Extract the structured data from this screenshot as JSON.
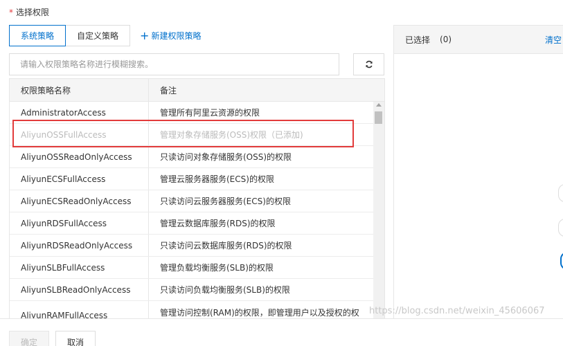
{
  "section": {
    "required_mark": "*",
    "label": "选择权限"
  },
  "tabs": [
    {
      "label": "系统策略",
      "active": true
    },
    {
      "label": "自定义策略",
      "active": false
    }
  ],
  "new_policy": {
    "plus": "+",
    "label": "新建权限策略"
  },
  "search": {
    "placeholder": "请输入权限策略名称进行模糊搜索。",
    "value": ""
  },
  "refresh": {
    "icon": "refresh-icon"
  },
  "table": {
    "headers": [
      "权限策略名称",
      "备注"
    ],
    "rows": [
      {
        "name": "AdministratorAccess",
        "note": "管理所有阿里云资源的权限",
        "disabled": false
      },
      {
        "name": "AliyunOSSFullAccess",
        "note": "管理对象存储服务(OSS)权限（已添加)",
        "disabled": true
      },
      {
        "name": "AliyunOSSReadOnlyAccess",
        "note": "只读访问对象存储服务(OSS)的权限",
        "disabled": false
      },
      {
        "name": "AliyunECSFullAccess",
        "note": "管理云服务器服务(ECS)的权限",
        "disabled": false
      },
      {
        "name": "AliyunECSReadOnlyAccess",
        "note": "只读访问云服务器服务(ECS)的权限",
        "disabled": false
      },
      {
        "name": "AliyunRDSFullAccess",
        "note": "管理云数据库服务(RDS)的权限",
        "disabled": false
      },
      {
        "name": "AliyunRDSReadOnlyAccess",
        "note": "只读访问云数据库服务(RDS)的权限",
        "disabled": false
      },
      {
        "name": "AliyunSLBFullAccess",
        "note": "管理负载均衡服务(SLB)的权限",
        "disabled": false
      },
      {
        "name": "AliyunSLBReadOnlyAccess",
        "note": "只读访问负载均衡服务(SLB)的权限",
        "disabled": false
      },
      {
        "name": "AliyunRAMFullAccess",
        "note": "管理访问控制(RAM)的权限，即管理用户以及授权的权",
        "disabled": false
      }
    ]
  },
  "selected": {
    "label": "已选择",
    "count": "(0)",
    "clear": "清空"
  },
  "footer": {
    "ok": "确定",
    "cancel": "取消"
  },
  "watermark": "https://blog.csdn.net/weixin_45606067",
  "colors": {
    "accent": "#0070cc",
    "highlight": "#e23b3b",
    "required": "#e4393c"
  }
}
